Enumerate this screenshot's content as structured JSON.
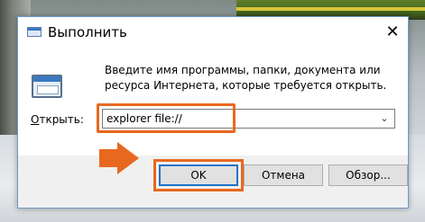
{
  "window": {
    "title": "Выполнить",
    "close_glyph": "✕"
  },
  "main": {
    "description": "Введите имя программы, папки, документа или ресурса Интернета, которые требуется открыть.",
    "open_label_prefix": "О",
    "open_label_rest": "ткрыть:",
    "command_value": "explorer file://",
    "dropdown_glyph": "⌄"
  },
  "buttons": {
    "ok": "OK",
    "cancel": "Отмена",
    "browse": "Обзор..."
  },
  "icons": {
    "title": "run-window-icon",
    "body": "run-window-icon",
    "close": "close-icon",
    "dropdown": "chevron-down-icon",
    "pointer": "arrow-right-icon"
  },
  "colors": {
    "highlight": "#e8681f",
    "accent": "#1e73c8"
  }
}
